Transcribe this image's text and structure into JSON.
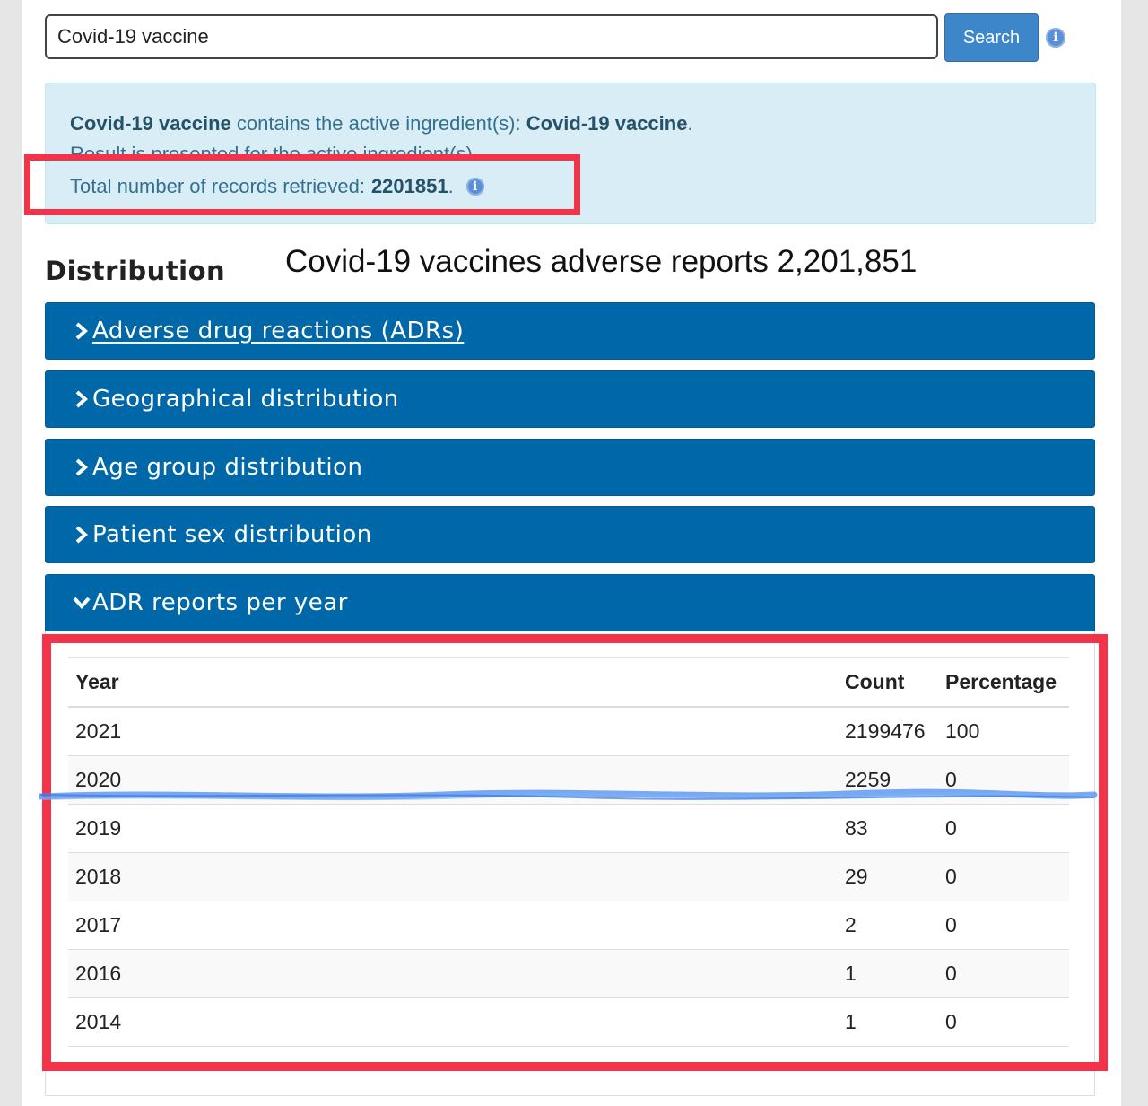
{
  "search": {
    "value": "Covid-19 vaccine",
    "button_label": "Search"
  },
  "alert": {
    "product_name": "Covid-19 vaccine",
    "contains_text": " contains the active ingredient(s): ",
    "ingredient_name": "Covid-19 vaccine",
    "period": ".",
    "result_text": "Result is presented for the active ingredient(s).",
    "total_label": "Total number of records retrieved:",
    "total_value": "2201851",
    "total_suffix": "."
  },
  "distribution_heading": "Distribution",
  "overlay_caption": "Covid-19 vaccines adverse reports 2,201,851",
  "panels": [
    {
      "label": "Adverse drug reactions (ADRs)",
      "expanded": false
    },
    {
      "label": "Geographical distribution",
      "expanded": false
    },
    {
      "label": "Age group distribution",
      "expanded": false
    },
    {
      "label": "Patient sex distribution",
      "expanded": false
    },
    {
      "label": "ADR reports per year",
      "expanded": true
    }
  ],
  "adr_table": {
    "headers": [
      "Year",
      "Count",
      "Percentage"
    ],
    "rows": [
      [
        "2021",
        "2199476",
        "100"
      ],
      [
        "2020",
        "2259",
        "0"
      ],
      [
        "2019",
        "83",
        "0"
      ],
      [
        "2018",
        "29",
        "0"
      ],
      [
        "2017",
        "2",
        "0"
      ],
      [
        "2016",
        "1",
        "0"
      ],
      [
        "2014",
        "1",
        "0"
      ]
    ]
  },
  "colors": {
    "panel_bg": "#0067a8",
    "button_bg": "#3d86c9",
    "alert_bg": "#d9edf7",
    "alert_text": "#31708f",
    "highlight_red": "#f2334a",
    "scribble_blue": "#4a8cf0"
  },
  "icons": {
    "info": "info-icon",
    "collapsed": "chevron-right-icon",
    "expanded": "chevron-down-icon"
  }
}
